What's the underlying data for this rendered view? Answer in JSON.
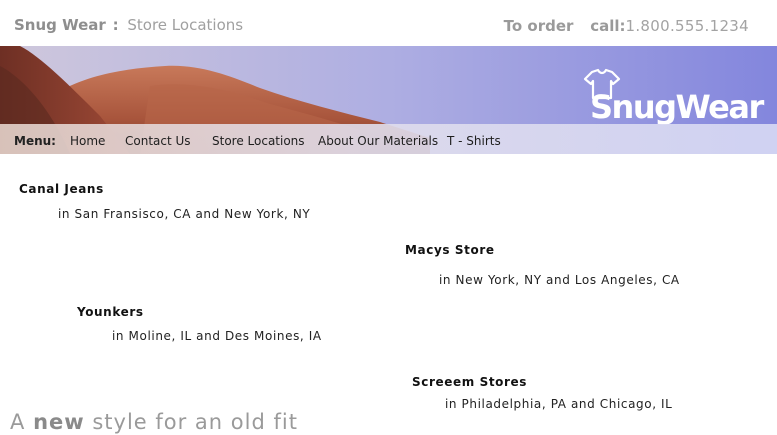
{
  "header": {
    "brand": "Snug Wear",
    "separator": ":",
    "section": "Store Locations",
    "to_order": "To order",
    "call_label": "call:",
    "phone": "1.800.555.1234"
  },
  "logo": {
    "text": "SnugWear",
    "icon": "t-shirt-icon"
  },
  "menu": {
    "label": "Menu:",
    "items": [
      {
        "label": "Home"
      },
      {
        "label": "Contact Us"
      },
      {
        "label": "Store Locations"
      },
      {
        "label": "About Our Materials"
      },
      {
        "label": "T - Shirts"
      }
    ]
  },
  "stores": [
    {
      "name": "Canal Jeans",
      "location": "in San Fransisco, CA and New York, NY"
    },
    {
      "name": "Macys Store",
      "location": "in New York, NY and Los Angeles, CA"
    },
    {
      "name": "Younkers",
      "location": "in Moline, IL and Des Moines, IA"
    },
    {
      "name": "Screeem Stores",
      "location": "in Philadelphia, PA and Chicago, IL"
    }
  ],
  "tagline": {
    "pre": "A",
    "strong": "new",
    "post": "style for an old fit"
  }
}
